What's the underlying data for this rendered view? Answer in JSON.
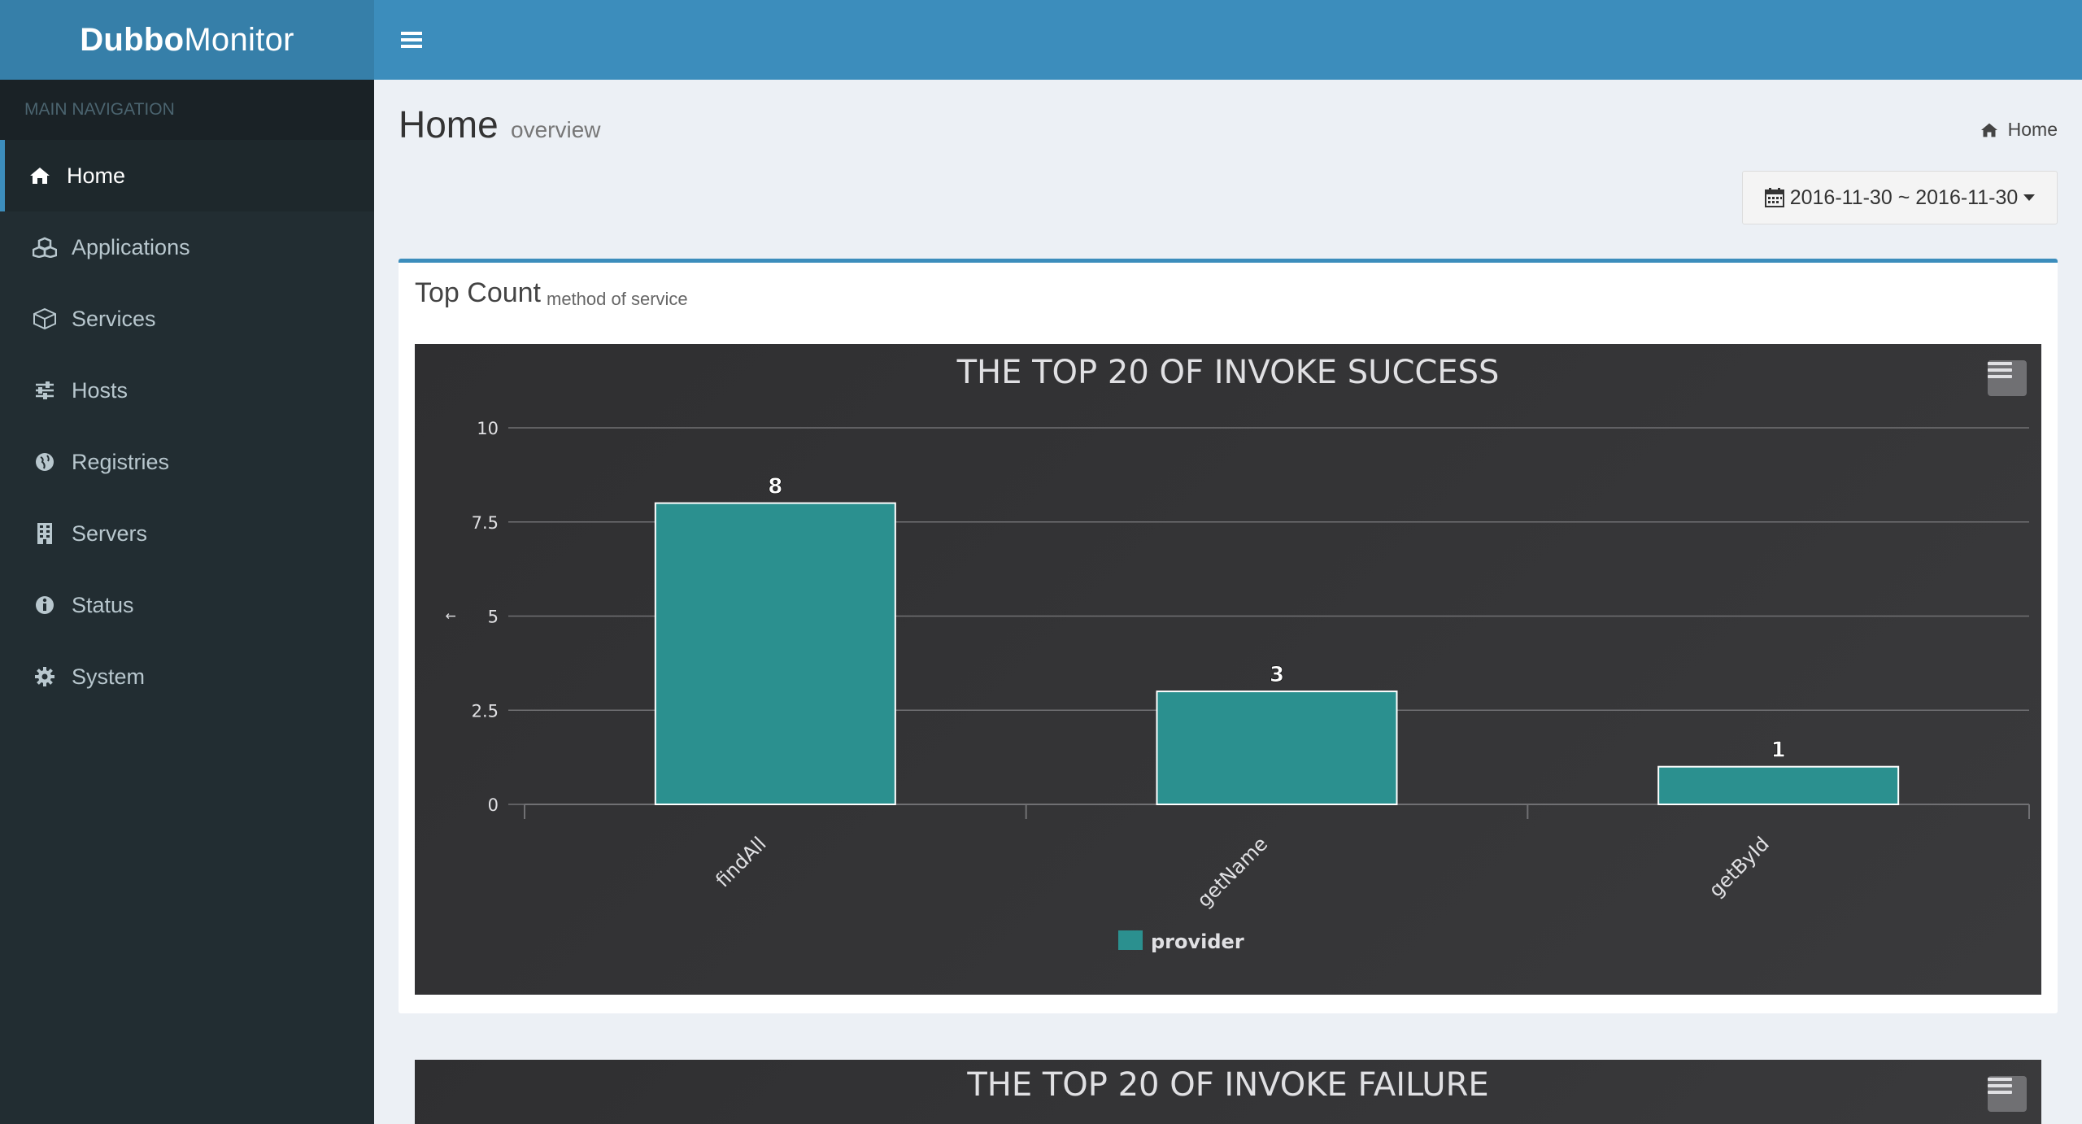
{
  "logo": {
    "bold": "Dubbo",
    "light": "Monitor"
  },
  "sidebar": {
    "header": "MAIN NAVIGATION",
    "items": [
      {
        "label": "Home",
        "icon": "home-icon"
      },
      {
        "label": "Applications",
        "icon": "cubes-icon"
      },
      {
        "label": "Services",
        "icon": "cube-icon"
      },
      {
        "label": "Hosts",
        "icon": "sliders-icon"
      },
      {
        "label": "Registries",
        "icon": "globe-icon"
      },
      {
        "label": "Servers",
        "icon": "building-icon"
      },
      {
        "label": "Status",
        "icon": "info-icon"
      },
      {
        "label": "System",
        "icon": "gear-icon"
      }
    ]
  },
  "page": {
    "title": "Home",
    "subtitle": "overview",
    "breadcrumb": "Home"
  },
  "date_range": {
    "label": "2016-11-30 ~ 2016-11-30"
  },
  "box": {
    "title": "Top Count",
    "subtitle": "method of service"
  },
  "colors": {
    "bar": "#2b908f",
    "header": "#3c8dbc",
    "logo": "#367fa9",
    "sidebar": "#222d32"
  },
  "chart_data": [
    {
      "type": "bar",
      "title": "THE TOP 20 OF INVOKE SUCCESS",
      "categories": [
        "findAll",
        "getName",
        "getById"
      ],
      "series": [
        {
          "name": "provider",
          "values": [
            8,
            3,
            1
          ]
        }
      ],
      "ylabel": "↑",
      "ylim": [
        0,
        10
      ],
      "yticks": [
        "0",
        "2.5",
        "5",
        "7.5",
        "10"
      ],
      "grid": true,
      "legend": "bottom-center"
    },
    {
      "type": "bar",
      "title": "THE TOP 20 OF INVOKE FAILURE"
    }
  ]
}
